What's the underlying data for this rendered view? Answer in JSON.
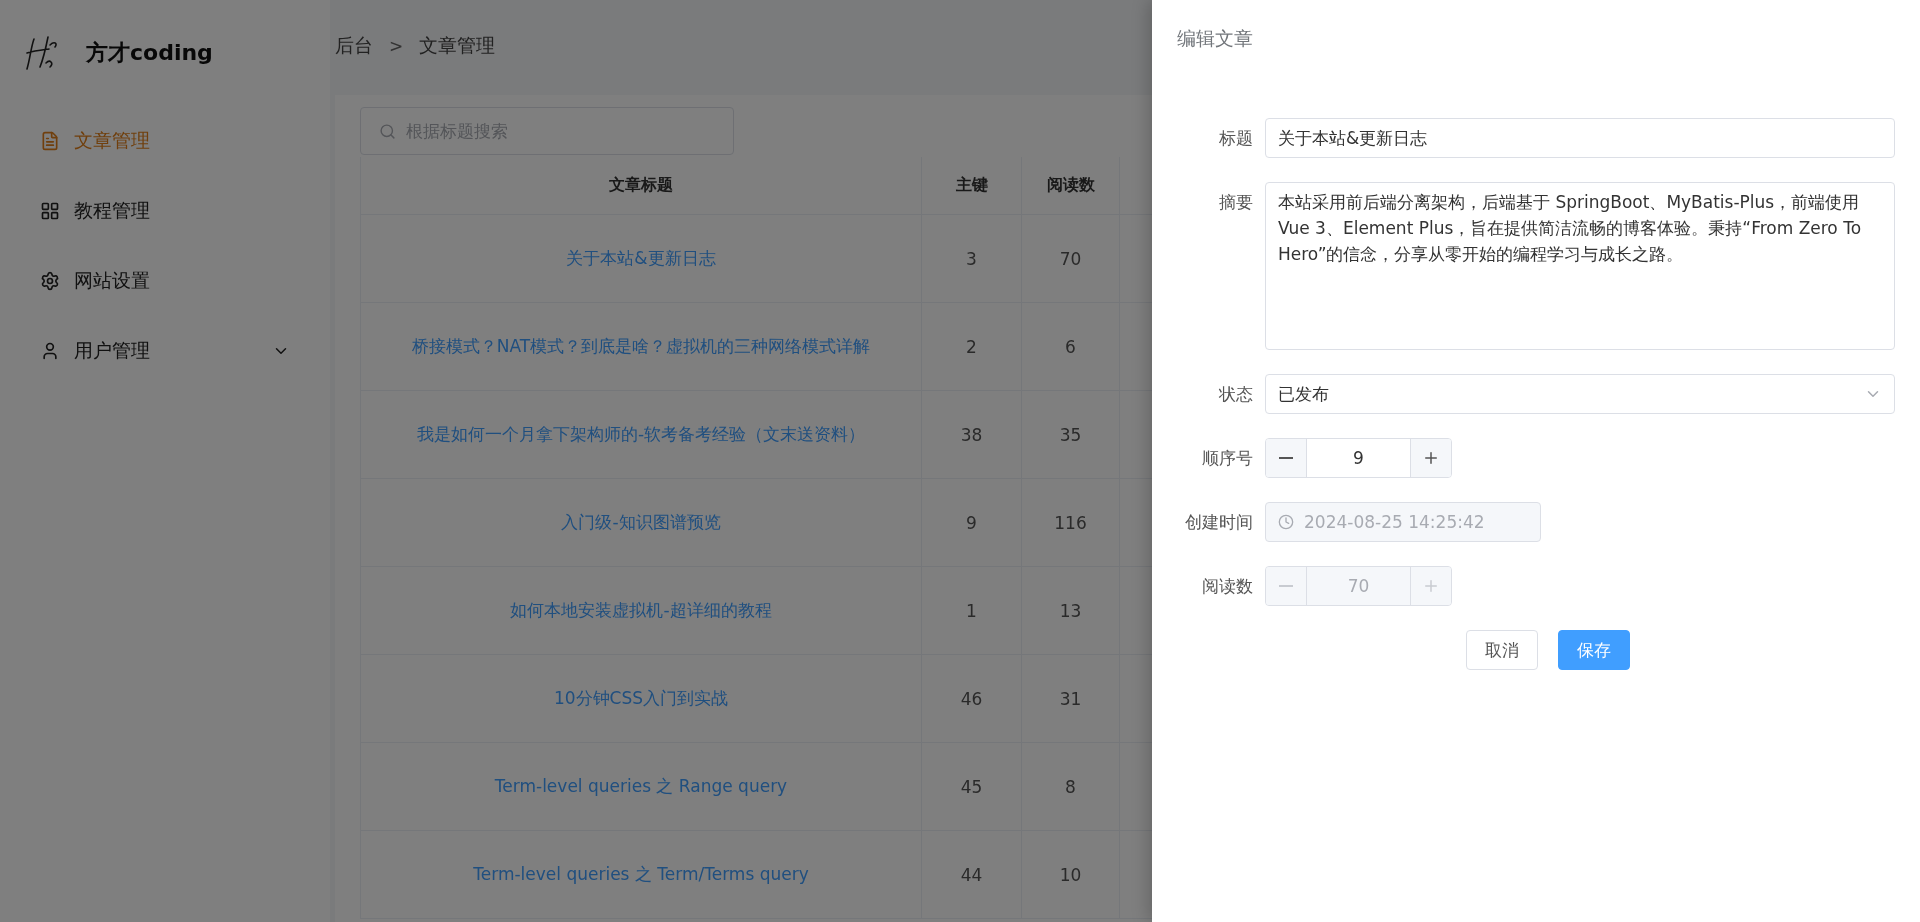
{
  "brand": {
    "name": "方才coding"
  },
  "sidebar": {
    "items": [
      {
        "label": "文章管理",
        "kind": "link",
        "selected": true
      },
      {
        "label": "教程管理",
        "kind": "link",
        "selected": false
      },
      {
        "label": "网站设置",
        "kind": "link",
        "selected": false
      },
      {
        "label": "用户管理",
        "kind": "group",
        "selected": false
      }
    ]
  },
  "breadcrumb": {
    "items": [
      "后台",
      "文章管理"
    ],
    "separator": ">"
  },
  "search": {
    "placeholder": "根据标题搜索"
  },
  "table": {
    "columns": [
      "文章标题",
      "主键",
      "阅读数"
    ],
    "rows": [
      [
        "关于本站&更新日志",
        "3",
        "70"
      ],
      [
        "桥接模式？NAT模式？到底是啥？虚拟机的三种网络模式详解",
        "2",
        "6"
      ],
      [
        "我是如何一个月拿下架构师的-软考备考经验（文末送资料）",
        "38",
        "35"
      ],
      [
        "入门级-知识图谱预览",
        "9",
        "116"
      ],
      [
        "如何本地安装虚拟机-超详细的教程",
        "1",
        "13"
      ],
      [
        "10分钟CSS入门到实战",
        "46",
        "31"
      ],
      [
        "Term-level queries 之 Range query",
        "45",
        "8"
      ],
      [
        "Term-level queries 之 Term/Terms query",
        "44",
        "10"
      ]
    ]
  },
  "drawer": {
    "title": "编辑文章",
    "fields": [
      {
        "label": "标题",
        "kind": "text",
        "value": "关于本站&更新日志",
        "disabled": false
      },
      {
        "label": "摘要",
        "kind": "textarea",
        "value": "本站采用前后端分离架构，后端基于 SpringBoot、MyBatis-Plus，前端使用 Vue 3、Element Plus，旨在提供简洁流畅的博客体验。秉持“From Zero To Hero”的信念，分享从零开始的编程学习与成长之路。",
        "disabled": false
      },
      {
        "label": "状态",
        "kind": "select",
        "value": "已发布",
        "disabled": false
      },
      {
        "label": "顺序号",
        "kind": "number",
        "value": "9",
        "disabled": false
      },
      {
        "label": "创建时间",
        "kind": "datetime",
        "value": "2024-08-25 14:25:42",
        "disabled": true
      },
      {
        "label": "阅读数",
        "kind": "number",
        "value": "70",
        "disabled": true
      }
    ],
    "buttons": [
      {
        "label": "取消",
        "kind": "default"
      },
      {
        "label": "保存",
        "kind": "primary"
      }
    ]
  }
}
